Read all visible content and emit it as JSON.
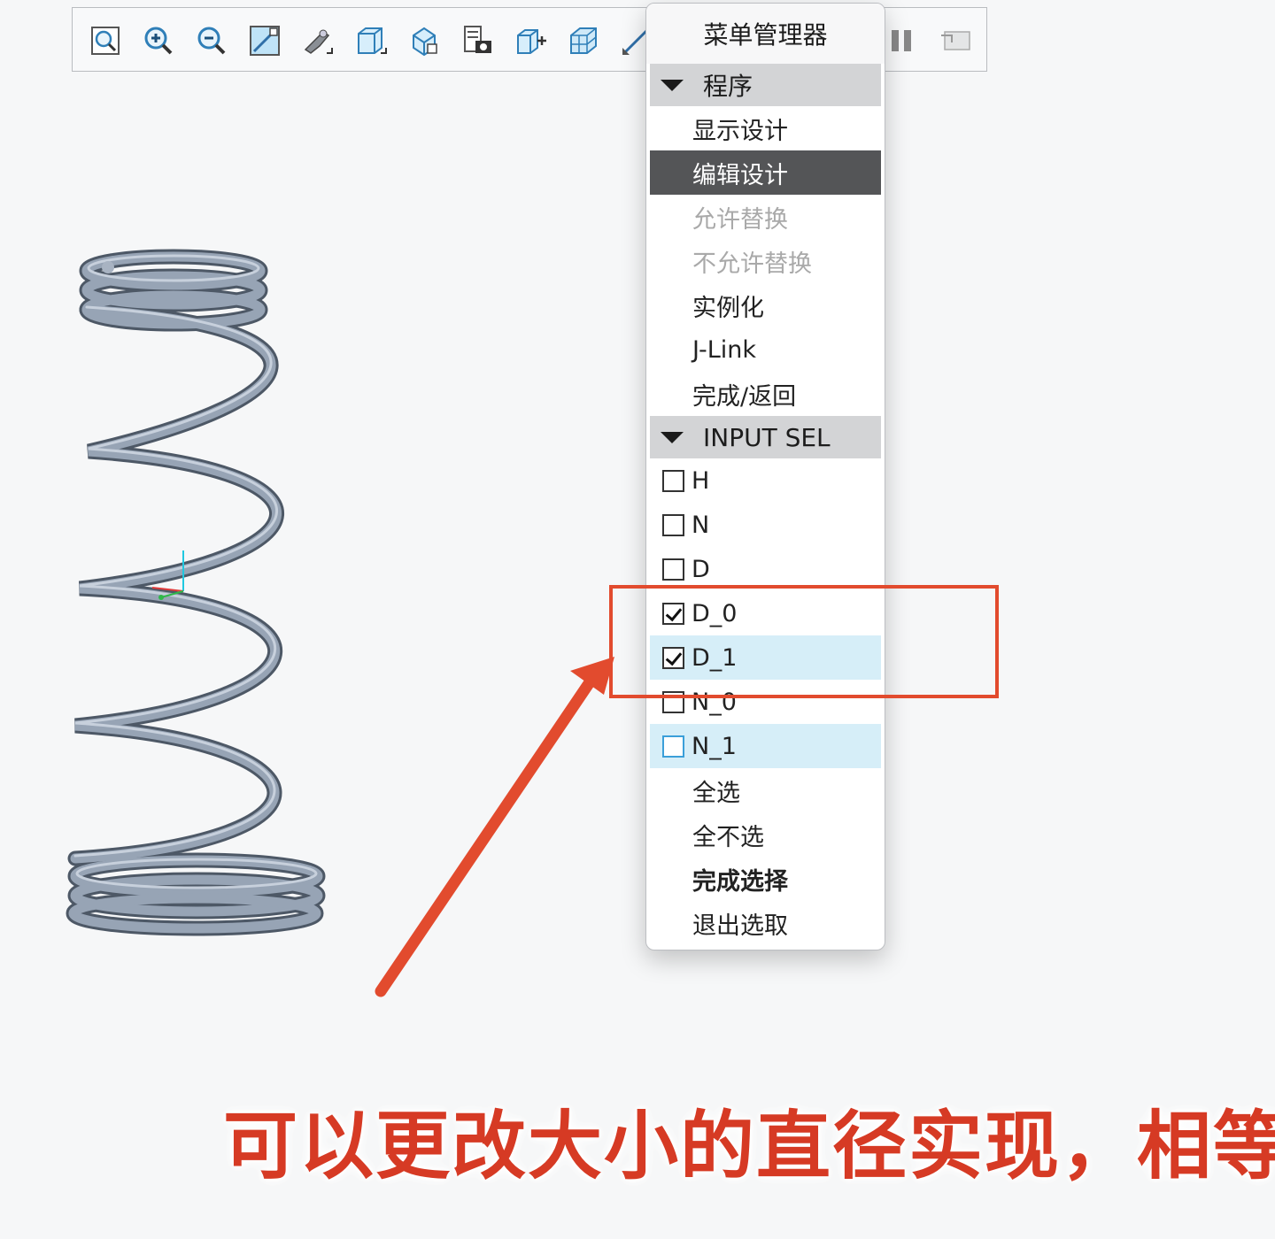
{
  "toolbar": {
    "icons": [
      "refit-icon",
      "zoom-in-icon",
      "zoom-out-icon",
      "repaint-icon",
      "spin-center-icon",
      "named-views-icon",
      "saved-orientations-icon",
      "view-manager-icon",
      "display-style-icon",
      "datum-display-icon",
      "perspective-icon",
      "pause-icon",
      "annotation-display-icon"
    ]
  },
  "menu": {
    "title": "菜单管理器",
    "section1": {
      "label": "程序",
      "items": [
        {
          "label": "显示设计",
          "state": "normal"
        },
        {
          "label": "编辑设计",
          "state": "selected"
        },
        {
          "label": "允许替换",
          "state": "disabled"
        },
        {
          "label": "不允许替换",
          "state": "disabled"
        },
        {
          "label": "实例化",
          "state": "normal"
        },
        {
          "label": "J-Link",
          "state": "normal"
        },
        {
          "label": "完成/返回",
          "state": "normal"
        }
      ]
    },
    "section2": {
      "label": "INPUT SEL",
      "checkboxes": [
        {
          "label": "H",
          "checked": false
        },
        {
          "label": "N",
          "checked": false
        },
        {
          "label": "D",
          "checked": false
        },
        {
          "label": "D_0",
          "checked": true
        },
        {
          "label": "D_1",
          "checked": true
        },
        {
          "label": "N_0",
          "checked": false
        },
        {
          "label": "N_1",
          "checked": false
        }
      ],
      "actions": [
        {
          "label": "全选",
          "bold": false
        },
        {
          "label": "全不选",
          "bold": false
        },
        {
          "label": "完成选择",
          "bold": true
        },
        {
          "label": "退出选取",
          "bold": false
        }
      ]
    }
  },
  "annotation": {
    "caption": "可以更改大小的直径实现，相等",
    "color": "#e24b2e"
  },
  "colors": {
    "selected_bg": "#545557",
    "highlight_bg": "#d6eef8",
    "section_bg": "#d3d4d6"
  }
}
